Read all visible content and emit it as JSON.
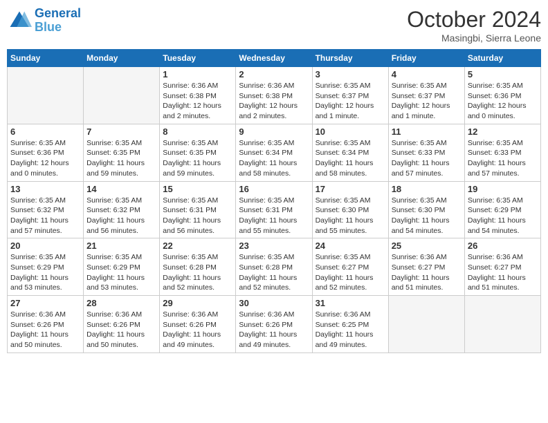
{
  "logo": {
    "line1": "General",
    "line2": "Blue"
  },
  "title": "October 2024",
  "location": "Masingbi, Sierra Leone",
  "days_of_week": [
    "Sunday",
    "Monday",
    "Tuesday",
    "Wednesday",
    "Thursday",
    "Friday",
    "Saturday"
  ],
  "weeks": [
    [
      {
        "day": "",
        "info": ""
      },
      {
        "day": "",
        "info": ""
      },
      {
        "day": "1",
        "info": "Sunrise: 6:36 AM\nSunset: 6:38 PM\nDaylight: 12 hours and 2 minutes."
      },
      {
        "day": "2",
        "info": "Sunrise: 6:36 AM\nSunset: 6:38 PM\nDaylight: 12 hours and 2 minutes."
      },
      {
        "day": "3",
        "info": "Sunrise: 6:35 AM\nSunset: 6:37 PM\nDaylight: 12 hours and 1 minute."
      },
      {
        "day": "4",
        "info": "Sunrise: 6:35 AM\nSunset: 6:37 PM\nDaylight: 12 hours and 1 minute."
      },
      {
        "day": "5",
        "info": "Sunrise: 6:35 AM\nSunset: 6:36 PM\nDaylight: 12 hours and 0 minutes."
      }
    ],
    [
      {
        "day": "6",
        "info": "Sunrise: 6:35 AM\nSunset: 6:36 PM\nDaylight: 12 hours and 0 minutes."
      },
      {
        "day": "7",
        "info": "Sunrise: 6:35 AM\nSunset: 6:35 PM\nDaylight: 11 hours and 59 minutes."
      },
      {
        "day": "8",
        "info": "Sunrise: 6:35 AM\nSunset: 6:35 PM\nDaylight: 11 hours and 59 minutes."
      },
      {
        "day": "9",
        "info": "Sunrise: 6:35 AM\nSunset: 6:34 PM\nDaylight: 11 hours and 58 minutes."
      },
      {
        "day": "10",
        "info": "Sunrise: 6:35 AM\nSunset: 6:34 PM\nDaylight: 11 hours and 58 minutes."
      },
      {
        "day": "11",
        "info": "Sunrise: 6:35 AM\nSunset: 6:33 PM\nDaylight: 11 hours and 57 minutes."
      },
      {
        "day": "12",
        "info": "Sunrise: 6:35 AM\nSunset: 6:33 PM\nDaylight: 11 hours and 57 minutes."
      }
    ],
    [
      {
        "day": "13",
        "info": "Sunrise: 6:35 AM\nSunset: 6:32 PM\nDaylight: 11 hours and 57 minutes."
      },
      {
        "day": "14",
        "info": "Sunrise: 6:35 AM\nSunset: 6:32 PM\nDaylight: 11 hours and 56 minutes."
      },
      {
        "day": "15",
        "info": "Sunrise: 6:35 AM\nSunset: 6:31 PM\nDaylight: 11 hours and 56 minutes."
      },
      {
        "day": "16",
        "info": "Sunrise: 6:35 AM\nSunset: 6:31 PM\nDaylight: 11 hours and 55 minutes."
      },
      {
        "day": "17",
        "info": "Sunrise: 6:35 AM\nSunset: 6:30 PM\nDaylight: 11 hours and 55 minutes."
      },
      {
        "day": "18",
        "info": "Sunrise: 6:35 AM\nSunset: 6:30 PM\nDaylight: 11 hours and 54 minutes."
      },
      {
        "day": "19",
        "info": "Sunrise: 6:35 AM\nSunset: 6:29 PM\nDaylight: 11 hours and 54 minutes."
      }
    ],
    [
      {
        "day": "20",
        "info": "Sunrise: 6:35 AM\nSunset: 6:29 PM\nDaylight: 11 hours and 53 minutes."
      },
      {
        "day": "21",
        "info": "Sunrise: 6:35 AM\nSunset: 6:29 PM\nDaylight: 11 hours and 53 minutes."
      },
      {
        "day": "22",
        "info": "Sunrise: 6:35 AM\nSunset: 6:28 PM\nDaylight: 11 hours and 52 minutes."
      },
      {
        "day": "23",
        "info": "Sunrise: 6:35 AM\nSunset: 6:28 PM\nDaylight: 11 hours and 52 minutes."
      },
      {
        "day": "24",
        "info": "Sunrise: 6:35 AM\nSunset: 6:27 PM\nDaylight: 11 hours and 52 minutes."
      },
      {
        "day": "25",
        "info": "Sunrise: 6:36 AM\nSunset: 6:27 PM\nDaylight: 11 hours and 51 minutes."
      },
      {
        "day": "26",
        "info": "Sunrise: 6:36 AM\nSunset: 6:27 PM\nDaylight: 11 hours and 51 minutes."
      }
    ],
    [
      {
        "day": "27",
        "info": "Sunrise: 6:36 AM\nSunset: 6:26 PM\nDaylight: 11 hours and 50 minutes."
      },
      {
        "day": "28",
        "info": "Sunrise: 6:36 AM\nSunset: 6:26 PM\nDaylight: 11 hours and 50 minutes."
      },
      {
        "day": "29",
        "info": "Sunrise: 6:36 AM\nSunset: 6:26 PM\nDaylight: 11 hours and 49 minutes."
      },
      {
        "day": "30",
        "info": "Sunrise: 6:36 AM\nSunset: 6:26 PM\nDaylight: 11 hours and 49 minutes."
      },
      {
        "day": "31",
        "info": "Sunrise: 6:36 AM\nSunset: 6:25 PM\nDaylight: 11 hours and 49 minutes."
      },
      {
        "day": "",
        "info": ""
      },
      {
        "day": "",
        "info": ""
      }
    ]
  ]
}
